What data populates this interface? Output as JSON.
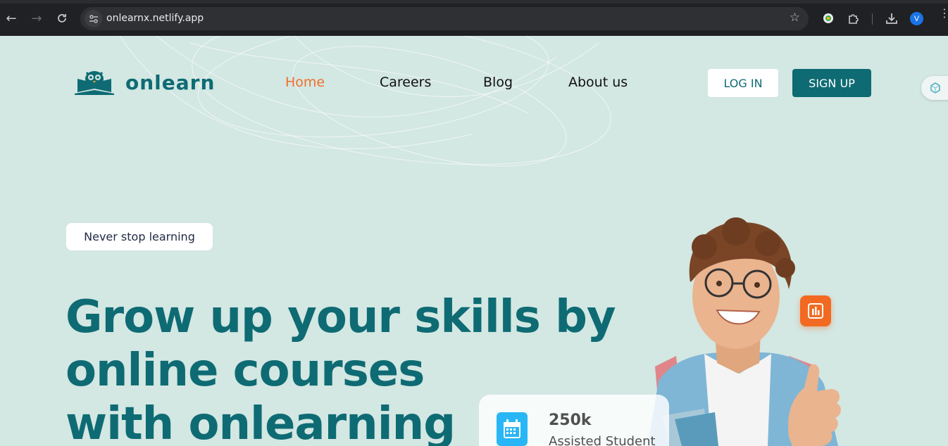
{
  "browser": {
    "url": "onlearnx.netlify.app",
    "profile_initial": "V"
  },
  "site": {
    "logo_text": "onlearn",
    "nav": [
      {
        "label": "Home",
        "active": true
      },
      {
        "label": "Careers",
        "active": false
      },
      {
        "label": "Blog",
        "active": false
      },
      {
        "label": "About us",
        "active": false
      }
    ],
    "login_label": "LOG IN",
    "signup_label": "SIGN UP"
  },
  "hero": {
    "tagline": "Never stop learning",
    "headline_lines": [
      "Grow up your skills by",
      "online courses",
      "with onlearning"
    ],
    "stat": {
      "value": "250k",
      "label": "Assisted Student"
    }
  },
  "colors": {
    "brand": "#0e6b73",
    "accent": "#f0702c",
    "background": "#d3e7e3",
    "stat_icon": "#29b6f6",
    "chart_badge": "#f26a21"
  },
  "icons": {
    "back": "arrow-left-icon",
    "forward": "arrow-right-icon",
    "reload": "reload-icon",
    "site_info": "tune-icon",
    "bookmark": "star-icon",
    "extensions": "puzzle-icon",
    "downloads": "download-icon",
    "menu": "kebab-menu-icon",
    "stat": "calendar-icon",
    "badge": "bar-chart-icon"
  }
}
